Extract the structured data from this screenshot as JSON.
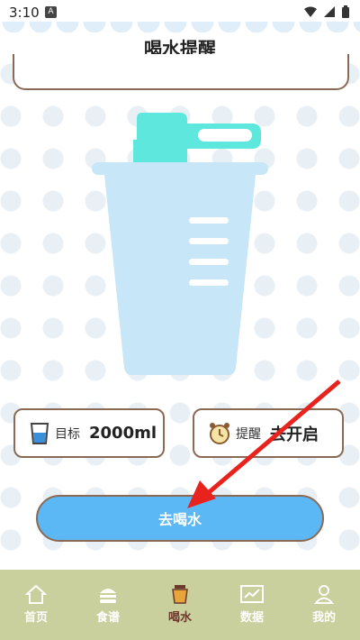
{
  "status_bar": {
    "time": "3:10",
    "badge": "A"
  },
  "header": {
    "title": "喝水提醒"
  },
  "goal_card": {
    "label": "目标",
    "value": "2000ml"
  },
  "reminder_card": {
    "label": "提醒",
    "value": "去开启"
  },
  "drink_button": {
    "label": "去喝水"
  },
  "tab_bar": {
    "items": [
      {
        "label": "首页",
        "icon": "home-icon"
      },
      {
        "label": "食谱",
        "icon": "burger-icon"
      },
      {
        "label": "喝水",
        "icon": "cup-icon",
        "active": true
      },
      {
        "label": "数据",
        "icon": "chart-icon"
      },
      {
        "label": "我的",
        "icon": "person-icon"
      }
    ]
  },
  "colors": {
    "accent_blue": "#5bb8f5",
    "cup_body": "#c7e6f7",
    "cup_lid": "#5ee7dc",
    "tab_bar_bg": "#c9cf9d",
    "border_brown": "#8a6a55",
    "active_tab": "#6b3a2a"
  }
}
